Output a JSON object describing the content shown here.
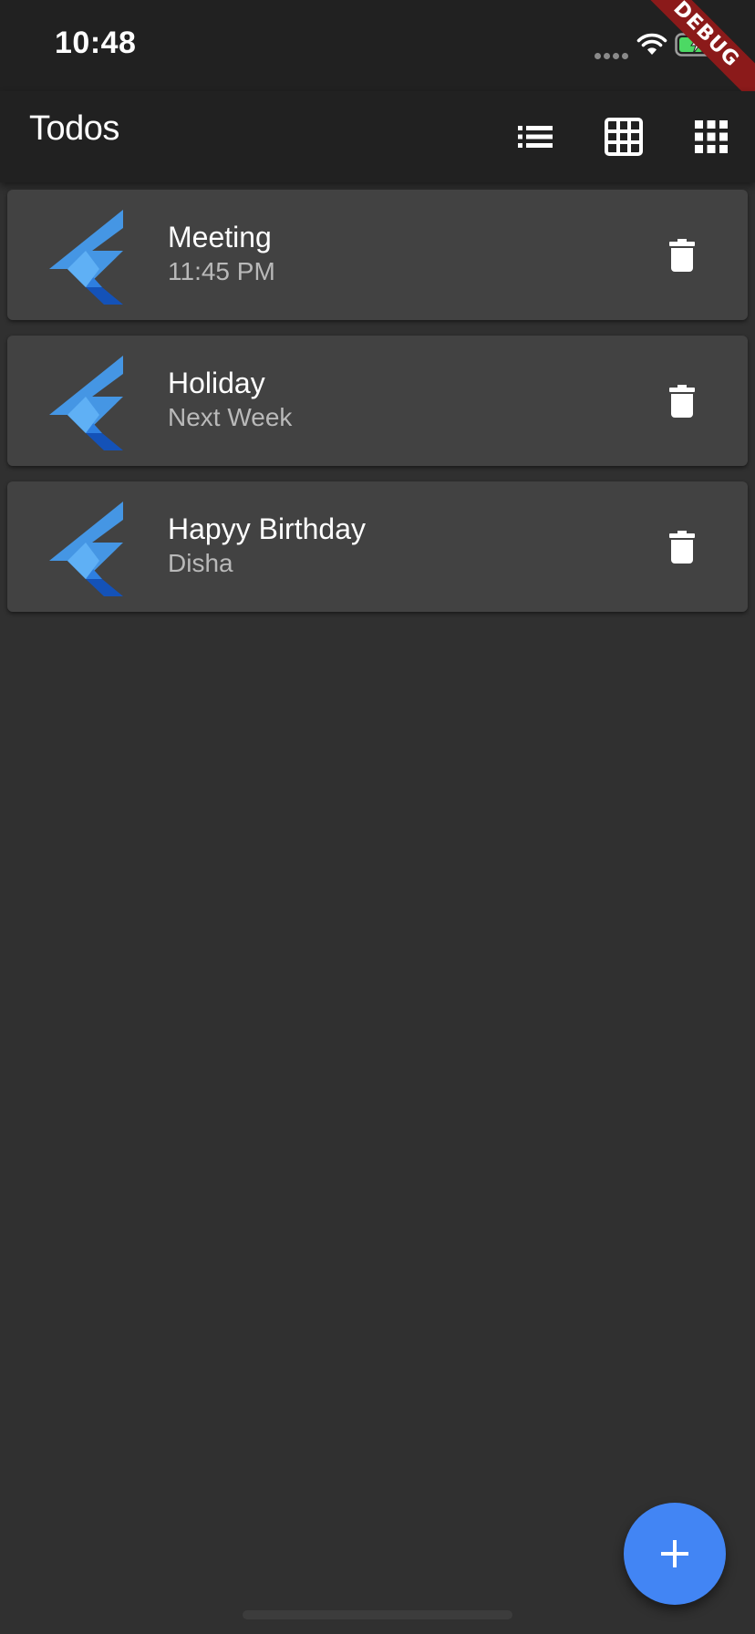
{
  "status_bar": {
    "time": "10:48",
    "icons": [
      "signal-dots-icon",
      "wifi-icon",
      "battery-charging-icon"
    ],
    "debug_banner": "DEBUG"
  },
  "app_bar": {
    "title": "Todos",
    "actions": [
      "list-view-icon",
      "grid-view-icon",
      "apps-view-icon"
    ]
  },
  "todos": [
    {
      "title": "Meeting",
      "subtitle": "11:45 PM",
      "icon": "flutter-logo-icon",
      "action_icon": "delete-icon"
    },
    {
      "title": "Holiday",
      "subtitle": "Next Week",
      "icon": "flutter-logo-icon",
      "action_icon": "delete-icon"
    },
    {
      "title": "Hapyy Birthday",
      "subtitle": "Disha",
      "icon": "flutter-logo-icon",
      "action_icon": "delete-icon"
    }
  ],
  "fab": {
    "icon": "add-icon"
  },
  "colors": {
    "background": "#303030",
    "app_bar": "#212121",
    "card": "#424242",
    "accent": "#4285f4",
    "subtitle": "#b9b9b9",
    "debug_ribbon": "#8b1a1a"
  }
}
